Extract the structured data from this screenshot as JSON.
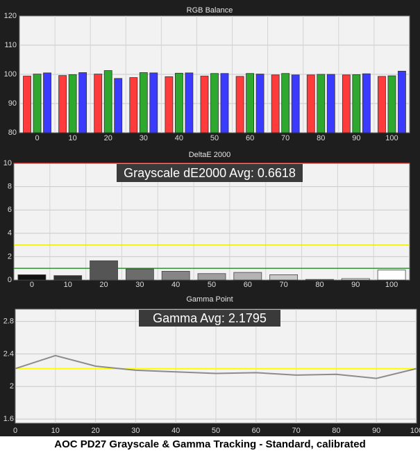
{
  "caption": "AOC PD27 Grayscale & Gamma Tracking - Standard, calibrated",
  "colors": {
    "background": "#1e1e1e",
    "plot_bg": "#f2f2f2",
    "red": "#ff3b3b",
    "green": "#2ea82e",
    "blue": "#3b3bff",
    "target_line": "#ffff00",
    "threshold_line": "#228b22",
    "max_line": "#ff3030"
  },
  "chart_data": [
    {
      "type": "bar",
      "title": "RGB Balance",
      "categories": [
        "0",
        "10",
        "20",
        "30",
        "40",
        "50",
        "60",
        "70",
        "80",
        "90",
        "100"
      ],
      "series": [
        {
          "name": "",
          "color": "#ff3b3b",
          "values": [
            99.4,
            99.6,
            100.1,
            98.9,
            99.2,
            99.4,
            99.3,
            99.8,
            99.8,
            99.8,
            99.3
          ]
        },
        {
          "name": "",
          "color": "#2ea82e",
          "values": [
            100.1,
            99.9,
            101.3,
            100.6,
            100.4,
            100.3,
            100.3,
            100.3,
            100.0,
            99.9,
            99.5
          ]
        },
        {
          "name": "",
          "color": "#3b3bff",
          "values": [
            100.5,
            100.6,
            98.6,
            100.5,
            100.5,
            100.3,
            100.1,
            99.8,
            100.0,
            100.2,
            101.1
          ]
        }
      ],
      "yticks": [
        "80",
        "90",
        "100",
        "110",
        "120"
      ],
      "ylim": [
        80,
        120
      ],
      "grid": true
    },
    {
      "type": "bar",
      "title": "DeltaE 2000",
      "annotation": "Grayscale dE2000 Avg: 0.6618",
      "categories": [
        "0",
        "10",
        "20",
        "30",
        "40",
        "50",
        "60",
        "70",
        "80",
        "90",
        "100"
      ],
      "values": [
        0.45,
        0.38,
        1.65,
        0.95,
        0.75,
        0.55,
        0.65,
        0.45,
        0.05,
        0.12,
        0.85
      ],
      "bar_colors": [
        "#111111",
        "#303030",
        "#555555",
        "#6c6c6c",
        "#858585",
        "#9e9e9e",
        "#b4b4b4",
        "#c8c8c8",
        "#dddddd",
        "#eeeeee",
        "#ffffff"
      ],
      "reference_lines": [
        {
          "value": 10,
          "color": "#ff3030"
        },
        {
          "value": 3,
          "color": "#e6e600"
        },
        {
          "value": 1,
          "color": "#228b22"
        }
      ],
      "yticks": [
        "0",
        "2",
        "4",
        "6",
        "8",
        "10"
      ],
      "ylim": [
        0,
        10
      ],
      "grid": true
    },
    {
      "type": "line",
      "title": "Gamma Point",
      "annotation": "Gamma Avg: 2.1795",
      "x": [
        0,
        10,
        20,
        30,
        40,
        50,
        60,
        70,
        80,
        90,
        100
      ],
      "y": [
        2.22,
        2.38,
        2.25,
        2.2,
        2.18,
        2.16,
        2.17,
        2.14,
        2.15,
        2.1,
        2.22
      ],
      "target": 2.22,
      "xticks": [
        "0",
        "10",
        "20",
        "30",
        "40",
        "50",
        "60",
        "70",
        "80",
        "90",
        "100"
      ],
      "yticks": [
        "1.6",
        "2",
        "2.4",
        "2.8"
      ],
      "xlim": [
        0,
        100
      ],
      "ylim": [
        1.55,
        2.95
      ],
      "grid": true
    }
  ]
}
